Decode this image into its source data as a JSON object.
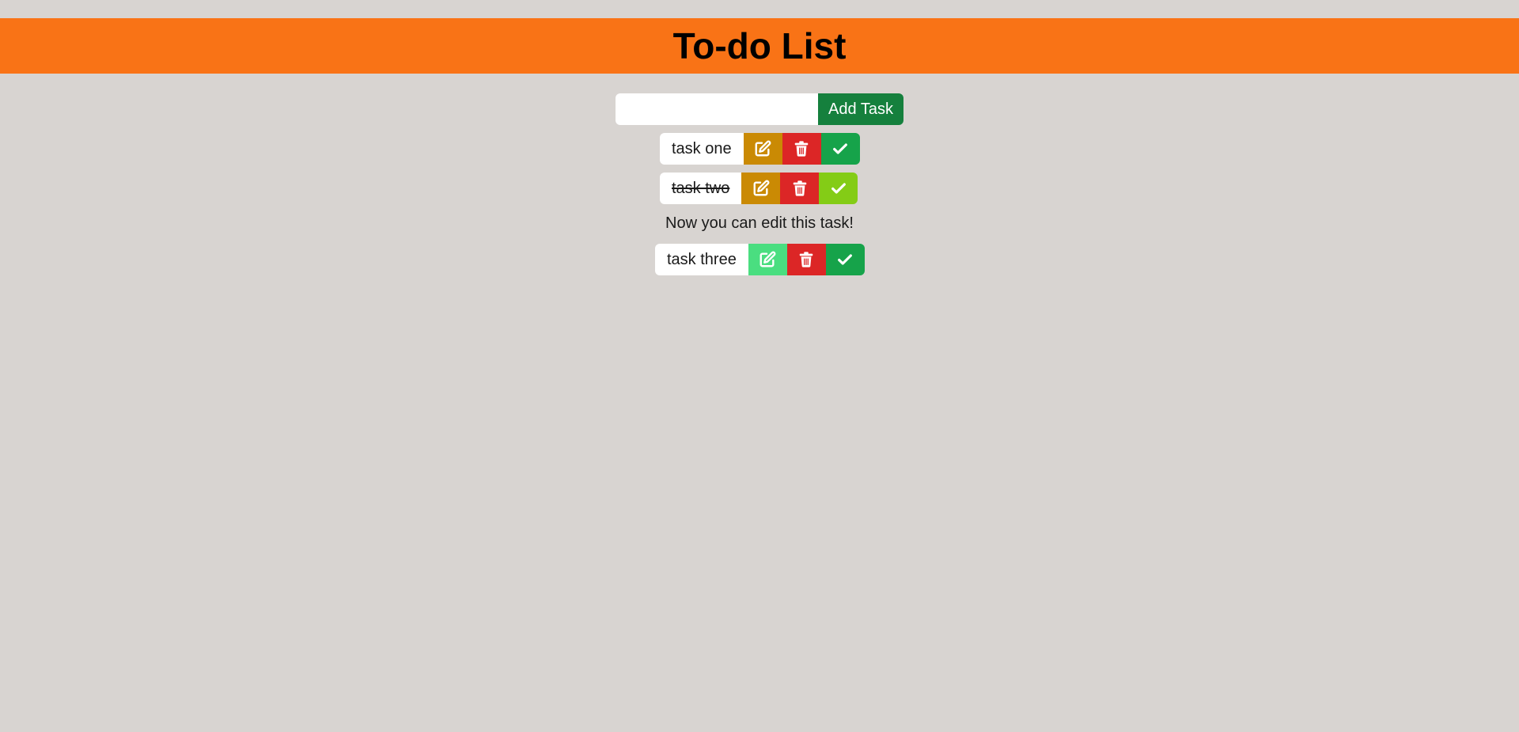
{
  "header": {
    "title": "To-do List"
  },
  "add_form": {
    "input_value": "",
    "placeholder": "",
    "button_label": "Add Task"
  },
  "tasks": [
    {
      "label": "task one",
      "completed": false,
      "editing": false
    },
    {
      "label": "task two",
      "completed": true,
      "editing": false
    },
    {
      "label": "task three",
      "completed": false,
      "editing": true
    }
  ],
  "edit_message": "Now you can edit this task!",
  "colors": {
    "background": "#d8d4d1",
    "header": "#f97316",
    "add_button": "#15803d",
    "edit_button": "#ca8a04",
    "edit_button_active": "#4ade80",
    "delete_button": "#dc2626",
    "complete_button": "#16a34a",
    "complete_button_done": "#84cc16"
  },
  "icons": {
    "edit": "edit-icon",
    "delete": "trash-icon",
    "complete": "check-icon"
  }
}
